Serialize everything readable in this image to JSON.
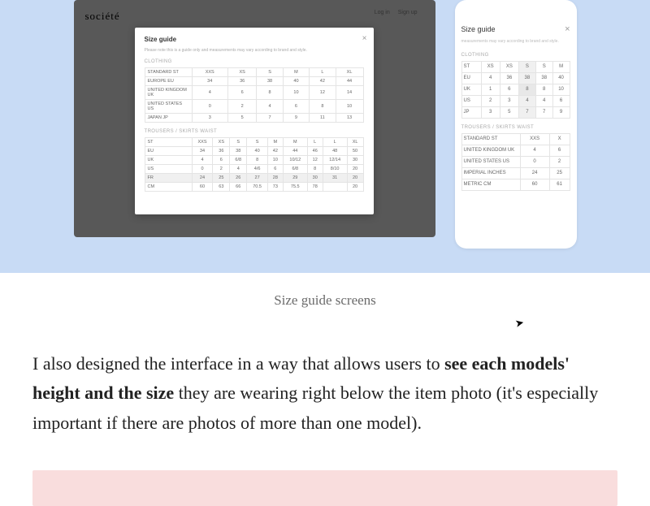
{
  "hero": {
    "brand": "société",
    "nav": {
      "login": "Log in",
      "signup": "Sign up"
    },
    "modal": {
      "title": "Size guide",
      "note": "Please note this is a guide only and measurements may vary according to brand and style.",
      "section1": "CLOTHING",
      "section2": "TROUSERS / SKIRTS WAIST",
      "t1_head": [
        "ST",
        "XXS",
        "XS",
        "S",
        "M",
        "L",
        "XL"
      ],
      "t1_rows": [
        [
          "STANDARD ST",
          "XXS",
          "XS",
          "S",
          "M",
          "L",
          "XL"
        ],
        [
          "EUROPE EU",
          "34",
          "36",
          "38",
          "40",
          "42",
          "44"
        ],
        [
          "UNITED KINGDOM UK",
          "4",
          "6",
          "8",
          "10",
          "12",
          "14"
        ],
        [
          "UNITED STATES US",
          "0",
          "2",
          "4",
          "6",
          "8",
          "10"
        ],
        [
          "JAPAN JP",
          "3",
          "5",
          "7",
          "9",
          "11",
          "13"
        ]
      ],
      "t2_head": [
        "ST",
        "XXS",
        "XS",
        "S",
        "S",
        "M",
        "M",
        "L",
        "L",
        "XL"
      ],
      "t2_rows": [
        [
          "EU",
          "34",
          "36",
          "38",
          "40",
          "42",
          "44",
          "46",
          "48",
          "50"
        ],
        [
          "UK",
          "4",
          "6",
          "6/8",
          "8",
          "10",
          "10/12",
          "12",
          "12/14",
          "30"
        ],
        [
          "US",
          "0",
          "2",
          "4",
          "4/6",
          "6",
          "6/8",
          "8",
          "8/10",
          "20"
        ],
        [
          "FR",
          "24",
          "25",
          "26",
          "27",
          "28",
          "29",
          "30",
          "31",
          "20"
        ],
        [
          "CM",
          "60",
          "63",
          "66",
          "70.5",
          "73",
          "75.5",
          "78",
          "",
          "20"
        ]
      ]
    }
  },
  "mobile": {
    "title": "Size guide",
    "note": "measurements may vary according to brand and style.",
    "section1": "CLOTHING",
    "section2": "TROUSERS / SKIRTS WAIST",
    "m1_head": [
      "ST",
      "XS",
      "XS",
      "S",
      "S",
      "M"
    ],
    "m1_rows": [
      [
        "EU",
        "4",
        "36",
        "38",
        "38",
        "40"
      ],
      [
        "UK",
        "1",
        "6",
        "8",
        "8",
        "10"
      ],
      [
        "US",
        "2",
        "3",
        "4",
        "4",
        "6"
      ],
      [
        "JP",
        "3",
        "5",
        "7",
        "7",
        "9"
      ]
    ],
    "m2_rows": [
      [
        "STANDARD ST",
        "XXS",
        "X"
      ],
      [
        "UNITED KINGDOM UK",
        "4",
        "6"
      ],
      [
        "UNITED STATES US",
        "0",
        "2"
      ],
      [
        "IMPERIAL INCHES",
        "24",
        "25"
      ],
      [
        "METRIC CM",
        "60",
        "61"
      ]
    ]
  },
  "caption": "Size guide screens",
  "para": {
    "p1a": "I also designed the interface in a way that allows users to ",
    "p1b": "see each models' height and the size",
    "p1c": " they are wearing right below the item photo (it's especially important if there are photos of more than one model)."
  }
}
